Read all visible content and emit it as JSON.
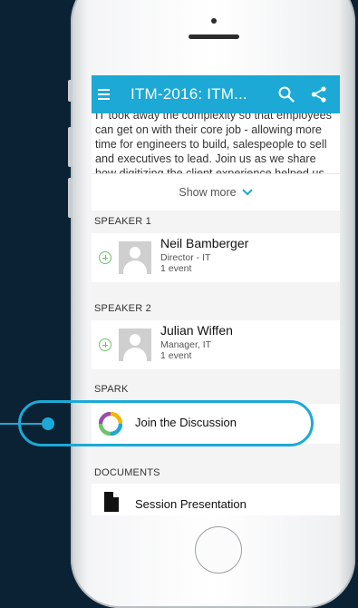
{
  "appbar": {
    "title": "ITM-2016: ITM...",
    "menu_icon": "hamburger-menu-icon",
    "search_icon": "search-icon",
    "share_icon": "share-icon"
  },
  "description": {
    "text": "IT took away the complexity so that employees can get on with their core job - allowing more time for engineers to build, salespeople to sell and executives to lead. Join us as we share how digitizing the client experience helped us achieve",
    "show_more_label": "Show more"
  },
  "speakers": [
    {
      "section": "SPEAKER 1",
      "name": "Neil Bamberger",
      "role": "Director - IT",
      "events": "1 event"
    },
    {
      "section": "SPEAKER 2",
      "name": "Julian Wiffen",
      "role": "Manager, IT",
      "events": "1 event"
    }
  ],
  "spark": {
    "section": "SPARK",
    "label": "Join the Discussion"
  },
  "documents": {
    "section": "DOCUMENTS",
    "label": "Session Presentation"
  },
  "colors": {
    "accent": "#1ca9d6",
    "add": "#6dc36d",
    "background": "#0a2233"
  }
}
